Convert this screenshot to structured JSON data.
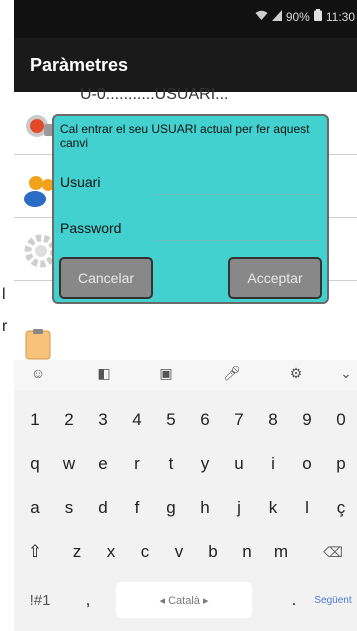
{
  "status_bar": {
    "battery_text": "90%",
    "time": "11:30"
  },
  "app_bar": {
    "title": "Paràmetres"
  },
  "list": {
    "row1_partial": "U-0...........USUARI..."
  },
  "dialog": {
    "message": "Cal entrar el seu USUARI actual per fer aquest canvi",
    "usuari_label": "Usuari",
    "password_label": "Password",
    "cancel_label": "Cancelar",
    "accept_label": "Acceptar"
  },
  "stray_chars": {
    "c1": "l",
    "c2": "r"
  },
  "keyboard": {
    "row1": [
      "1",
      "2",
      "3",
      "4",
      "5",
      "6",
      "7",
      "8",
      "9",
      "0"
    ],
    "row2": [
      "q",
      "w",
      "e",
      "r",
      "t",
      "y",
      "u",
      "i",
      "o",
      "p"
    ],
    "row3": [
      "a",
      "s",
      "d",
      "f",
      "g",
      "h",
      "j",
      "k",
      "l",
      "ç"
    ],
    "row4": [
      "z",
      "x",
      "c",
      "v",
      "b",
      "n",
      "m"
    ],
    "symbols_key": "!#1",
    "comma_key": ",",
    "space_label": "◂ Català ▸",
    "period_key": ".",
    "next_key": "Següent"
  },
  "colors": {
    "dialog_bg": "#42d1cf",
    "button_bg": "#888888"
  }
}
